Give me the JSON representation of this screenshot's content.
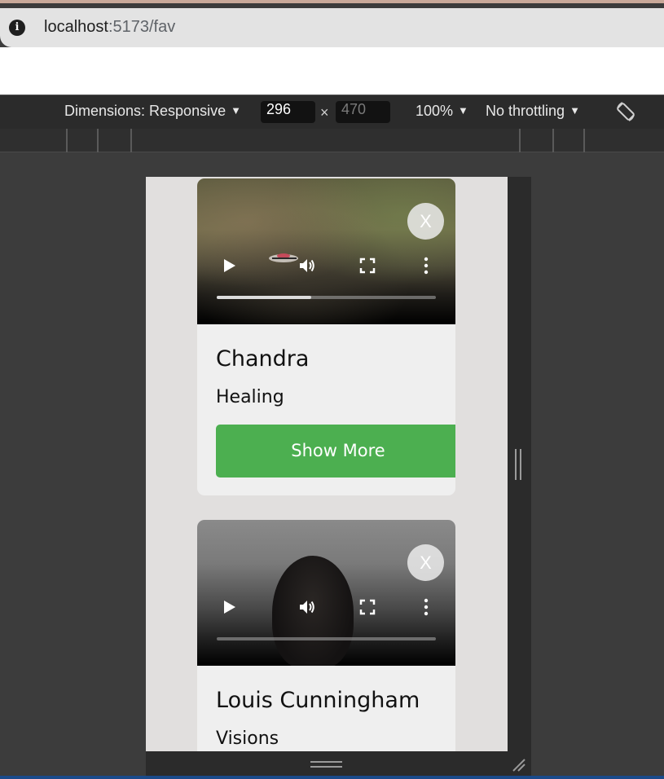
{
  "browser": {
    "url_host": "localhost",
    "url_path": ":5173/fav"
  },
  "devtools": {
    "dimensions_label": "Dimensions: Responsive",
    "width_value": "296",
    "height_placeholder": "470",
    "times": "×",
    "zoom": "100%",
    "throttling": "No throttling"
  },
  "cards": [
    {
      "name": "Chandra",
      "subtitle": "Healing",
      "close_label": "X",
      "progress_fraction": 0.43,
      "button_label": "Show More"
    },
    {
      "name": "Louis Cunningham",
      "subtitle": "Visions",
      "close_label": "X",
      "progress_fraction": 0.0
    }
  ]
}
